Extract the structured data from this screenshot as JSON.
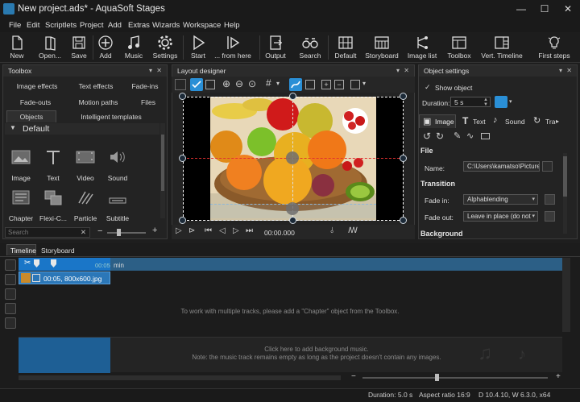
{
  "window": {
    "title": "New project.ads* - AquaSoft Stages",
    "minimize": "—",
    "maximize": "☐",
    "close": "✕"
  },
  "menu": [
    "File",
    "Edit",
    "Scriptlets",
    "Project",
    "Add",
    "Extras",
    "Wizards",
    "Workspace",
    "Help"
  ],
  "toolbar": {
    "new": "New",
    "open": "Open...",
    "save": "Save",
    "add": "Add",
    "music": "Music",
    "settings": "Settings",
    "start": "Start",
    "from_here": "... from here",
    "output": "Output",
    "search": "Search",
    "default": "Default",
    "storyboard": "Storyboard",
    "image_list": "Image list",
    "toolbox": "Toolbox",
    "vert_timeline": "Vert. Timeline",
    "first_steps": "First steps"
  },
  "toolbox": {
    "title": "Toolbox",
    "tabs_row1": [
      "Image effects",
      "Text effects",
      "Fade-ins"
    ],
    "tabs_row2": [
      "Fade-outs",
      "Motion paths",
      "Files"
    ],
    "tabs_row3": [
      "Objects",
      "Intelligent templates"
    ],
    "group": "Default",
    "objects": [
      "Image",
      "Text",
      "Video",
      "Sound",
      "Chapter",
      "Flexi-C...",
      "Particle",
      "Subtitle"
    ],
    "search_placeholder": "Search",
    "clear": "✕"
  },
  "layout": {
    "title": "Layout designer",
    "timecode": "00:00.000"
  },
  "settings": {
    "title": "Object settings",
    "show_object": "Show object",
    "duration_label": "Duration:",
    "duration_value": "5 s",
    "tabs": [
      "Image",
      "Text",
      "Sound",
      "Tra"
    ],
    "file_section": "File",
    "name_label": "Name:",
    "name_value": "C:\\Users\\kamatso\\Pictures",
    "transition_section": "Transition",
    "fade_in_label": "Fade in:",
    "fade_in_value": "Alphablending",
    "fade_out_label": "Fade out:",
    "fade_out_value": "Leave in place (do not",
    "background_section": "Background"
  },
  "timeline": {
    "tabs": [
      "Timeline",
      "Storyboard"
    ],
    "ruler_mark": "00:05",
    "ruler_unit": "min",
    "clip_label": "00:05, 800x600.jpg",
    "tracks_hint": "To work with multiple tracks, please add a \"Chapter\" object from the Toolbox.",
    "music_hint1": "Click here to add background music.",
    "music_hint2": "Note: the music track remains empty as long as the project doesn't contain any images."
  },
  "status": {
    "duration": "Duration: 5.0 s",
    "aspect": "Aspect ratio 16:9",
    "version": "D 10.4.10, W 6.3.0, x64"
  },
  "colors": {
    "accent": "#2a8fd6",
    "clip": "#2b77b8",
    "panel": "#232323"
  }
}
